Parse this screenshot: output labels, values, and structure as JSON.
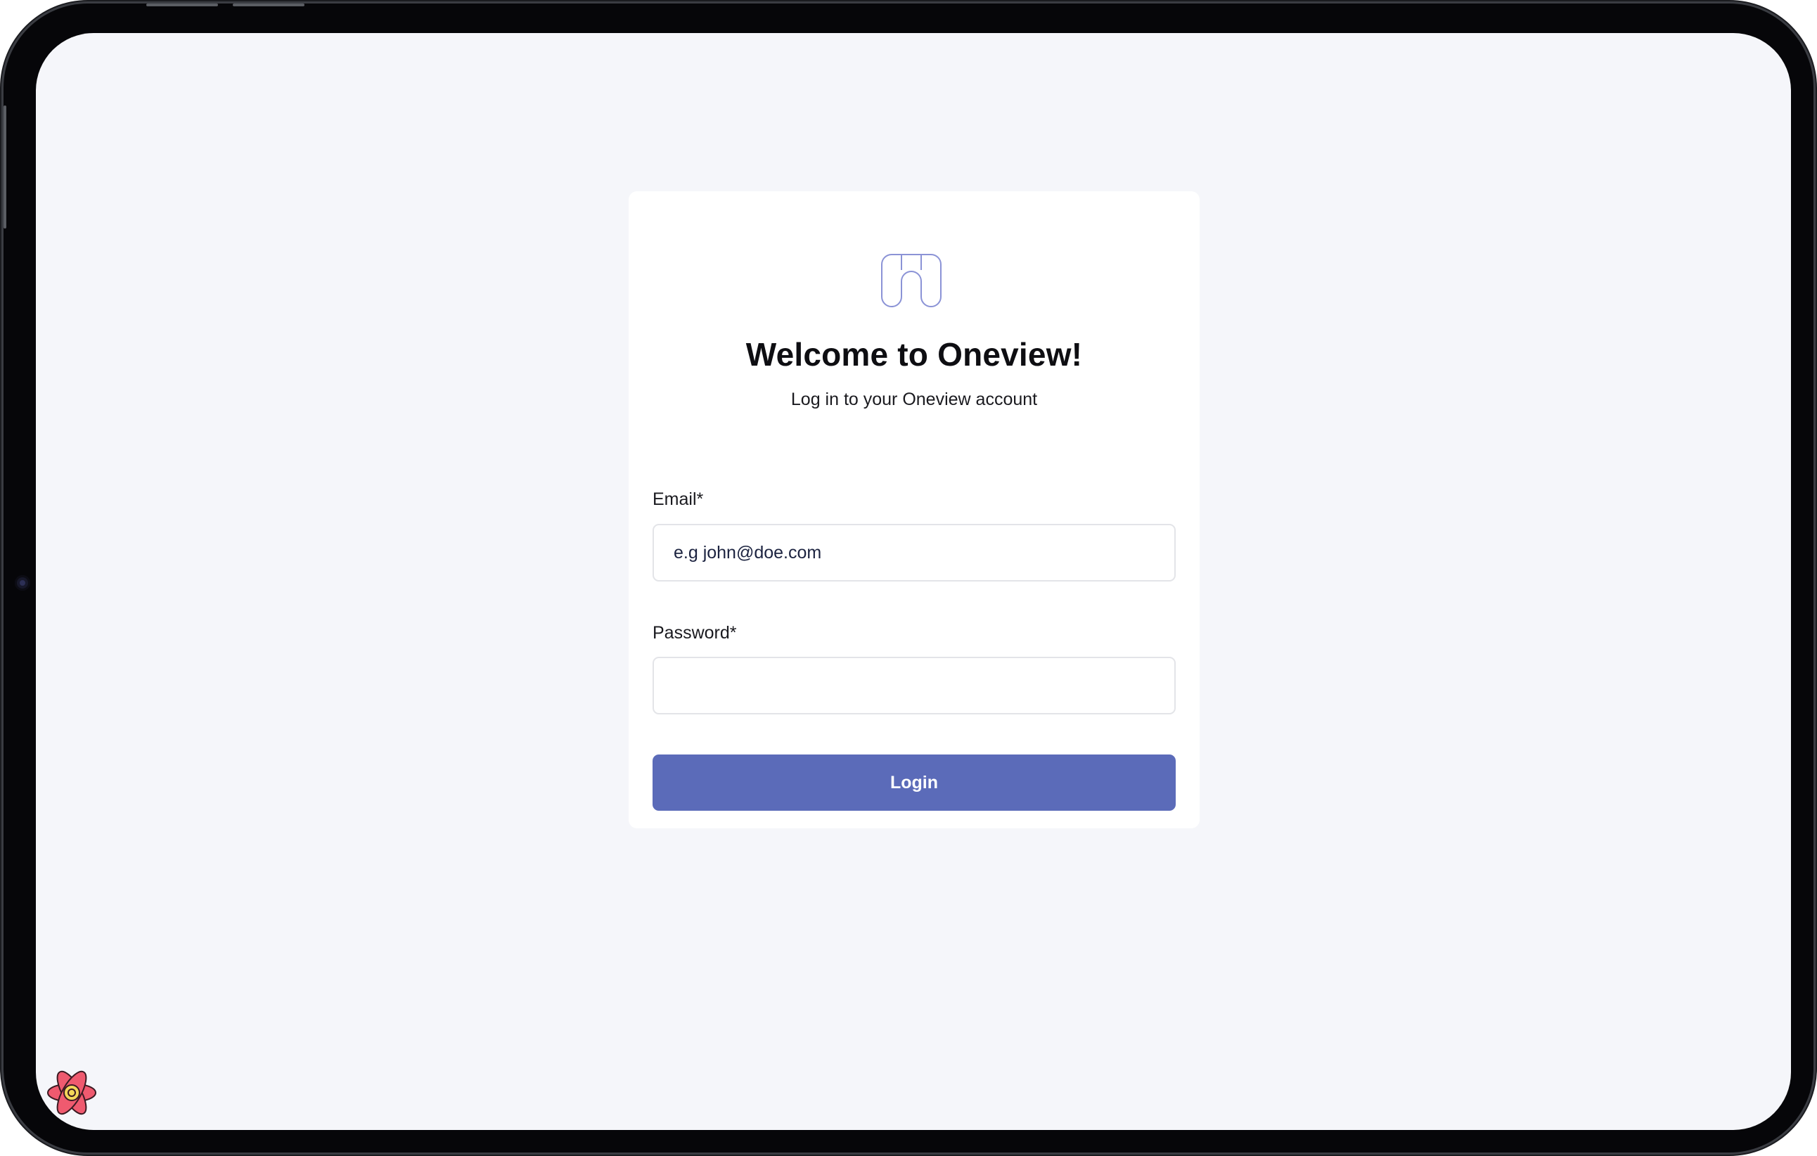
{
  "login": {
    "title": "Welcome to Oneview!",
    "subtitle": "Log in to your Oneview account",
    "email_label": "Email*",
    "email_placeholder": "e.g john@doe.com",
    "password_label": "Password*",
    "password_value": "",
    "login_button": "Login"
  },
  "icons": {
    "brand_logo": "oneview-logo-icon",
    "dev_badge": "react-icon"
  },
  "colors": {
    "background": "#f5f6fa",
    "card": "#ffffff",
    "primary_button": "#5b6bb9",
    "logo_stroke": "#8b93d6",
    "device_frame": "#060609"
  }
}
